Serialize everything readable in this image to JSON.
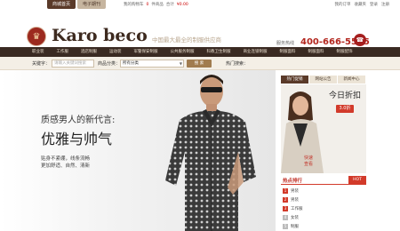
{
  "topbar": {
    "tabs": [
      "商城首页",
      "电子期刊"
    ],
    "links": [
      {
        "label": "我的购物车",
        "count": "0",
        "unit": "件商品"
      },
      {
        "label": "合计",
        "count": "¥0.00"
      }
    ],
    "right_links": [
      "我的订单",
      "收藏夹",
      "登录",
      "注册"
    ]
  },
  "header": {
    "logo_text": "Karo beco",
    "tagline": "中国最大最全的制服供应商",
    "hotline_label": "服务热线",
    "hotline_number": "400-666-5565"
  },
  "nav": {
    "items": [
      "职业装",
      "工作服",
      "酒店制服",
      "运动装",
      "军警保安制服",
      "公共服务制服",
      "科教卫生制服",
      "商业连锁制服",
      "制服面料",
      "制服面料",
      "制服配饰"
    ]
  },
  "search": {
    "keyword_label": "关键字：",
    "keyword_placeholder": "请输入关键词搜索",
    "category_label": "商品分类：",
    "category_value": "所有分类",
    "button_label": "搜 索",
    "hot_label": "热门搜索："
  },
  "hero": {
    "subtitle": "质感男人的新代言:",
    "title": "优雅与帅气",
    "body_lines": [
      "贴身不紧绷，线条流畅",
      "更加舒适、自然、清新"
    ]
  },
  "right_panel": {
    "tabs": [
      "热门促销",
      "网站公告",
      "新闻中心"
    ],
    "promo_title": "今日折扣",
    "promo_badge": "3.0折",
    "promo_side": [
      "快速",
      "查看"
    ],
    "hot_title": "热点排行",
    "hot_badge": "HOT",
    "hot_items": [
      {
        "rank": "1",
        "label": "男装"
      },
      {
        "rank": "2",
        "label": "男装"
      },
      {
        "rank": "3",
        "label": "工作服"
      },
      {
        "rank": "4",
        "label": "女装"
      },
      {
        "rank": "5",
        "label": "制服"
      }
    ]
  },
  "colors": {
    "brand_dark": "#3a2a22",
    "brand_brown": "#5a3a29",
    "accent_red": "#d23a2a",
    "hotline_red": "#b3261e"
  }
}
